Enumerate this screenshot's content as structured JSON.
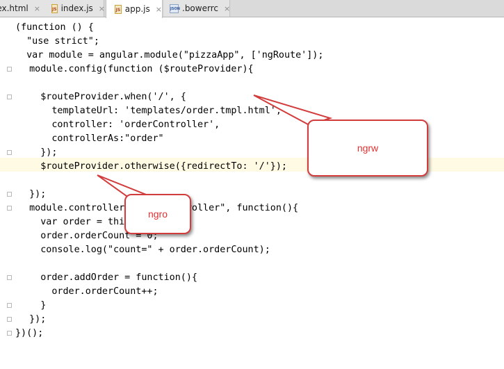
{
  "tabs": [
    {
      "label": "lex.html",
      "icon": "html-file-icon",
      "active": false
    },
    {
      "label": "index.js",
      "icon": "js-file-icon",
      "active": false
    },
    {
      "label": "app.js",
      "icon": "js-file-icon",
      "active": true
    },
    {
      "label": ".bowerrc",
      "icon": "json-file-icon",
      "active": false
    }
  ],
  "tab_close_glyph": "×",
  "icon_labels": {
    "js": "JS",
    "json": "JSON"
  },
  "callouts": {
    "first": "ngrw",
    "second": "ngro"
  },
  "code_text": {
    "l1": "(function () {",
    "l2": "  \"use strict\";",
    "l3": "  var module = angular.module(\"pizzaApp\", ['ngRoute']);",
    "l4": "  module.config(function ($routeProvider){",
    "l6": "    $routeProvider.when('/', {",
    "l7": "      templateUrl: 'templates/order.tmpl.html',",
    "l8": "      controller: 'orderController',",
    "l9": "      controllerAs:\"order\"",
    "l10": "    });",
    "l11": "    $routeProvider.otherwise({redirectTo: '/'});",
    "l13": "  });",
    "l14": "  module.controller(\"orderController\", function(){",
    "l15": "    var order = this;",
    "l16": "    order.orderCount = 0;",
    "l17": "    console.log(\"count=\" + order.orderCount);",
    "l19": "    order.addOrder = function(){",
    "l20": "      order.orderCount++;",
    "l21": "    }",
    "l22": "  });",
    "l23": "})();"
  },
  "colors": {
    "callout_border": "#d23c3c",
    "callout_text": "#e03030",
    "keyword": "#000080",
    "string": "#008000",
    "current_line": "#fffae3"
  }
}
